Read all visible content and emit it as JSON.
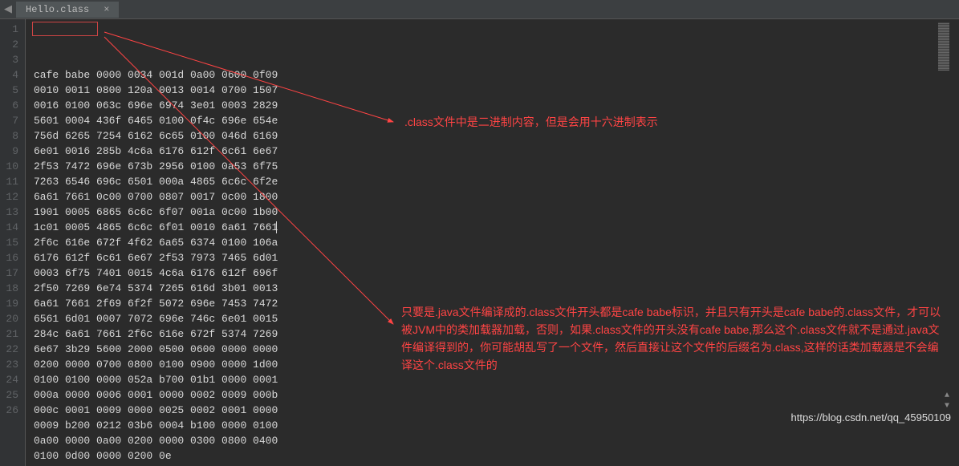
{
  "tab": {
    "name": "Hello.class",
    "close_glyph": "×",
    "prev_glyph": "◀"
  },
  "gutter": [
    "1",
    "2",
    "3",
    "4",
    "5",
    "6",
    "7",
    "8",
    "9",
    "10",
    "11",
    "12",
    "13",
    "14",
    "15",
    "16",
    "17",
    "18",
    "19",
    "20",
    "21",
    "22",
    "23",
    "24",
    "25",
    "26"
  ],
  "lines": [
    "cafe babe 0000 0034 001d 0a00 0600 0f09",
    "0010 0011 0800 120a 0013 0014 0700 1507",
    "0016 0100 063c 696e 6974 3e01 0003 2829",
    "5601 0004 436f 6465 0100 0f4c 696e 654e",
    "756d 6265 7254 6162 6c65 0100 046d 6169",
    "6e01 0016 285b 4c6a 6176 612f 6c61 6e67",
    "2f53 7472 696e 673b 2956 0100 0a53 6f75",
    "7263 6546 696c 6501 000a 4865 6c6c 6f2e",
    "6a61 7661 0c00 0700 0807 0017 0c00 1800",
    "1901 0005 6865 6c6c 6f07 001a 0c00 1b00",
    "1c01 0005 4865 6c6c 6f01 0010 6a61 7661",
    "2f6c 616e 672f 4f62 6a65 6374 0100 106a",
    "6176 612f 6c61 6e67 2f53 7973 7465 6d01",
    "0003 6f75 7401 0015 4c6a 6176 612f 696f",
    "2f50 7269 6e74 5374 7265 616d 3b01 0013",
    "6a61 7661 2f69 6f2f 5072 696e 7453 7472",
    "6561 6d01 0007 7072 696e 746c 6e01 0015",
    "284c 6a61 7661 2f6c 616e 672f 5374 7269",
    "6e67 3b29 5600 2000 0500 0600 0000 0000",
    "0200 0000 0700 0800 0100 0900 0000 1d00",
    "0100 0100 0000 052a b700 01b1 0000 0001",
    "000a 0000 0006 0001 0000 0002 0009 000b",
    "000c 0001 0009 0000 0025 0002 0001 0000",
    "0009 b200 0212 03b6 0004 b100 0000 0100",
    "0a00 0000 0a00 0200 0000 0300 0800 0400",
    "0100 0d00 0000 0200 0e"
  ],
  "annotations": {
    "note1": ".class文件中是二进制内容，但是会用十六进制表示",
    "note2": "只要是.java文件编译成的.class文件开头都是cafe babe标识，并且只有开头是cafe babe的.class文件，才可以被JVM中的类加载器加载，否则，如果.class文件的开头没有cafe babe,那么这个.class文件就不是通过.java文件编译得到的，你可能胡乱写了一个文件，然后直接让这个文件的后缀名为.class,这样的话类加载器是不会编译这个.class文件的"
  },
  "watermark": "https://blog.csdn.net/qq_45950109"
}
